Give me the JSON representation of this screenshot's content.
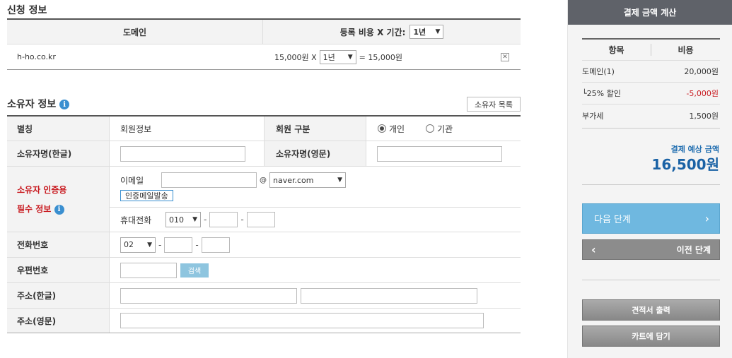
{
  "application": {
    "title": "신청 정보",
    "col_domain": "도메인",
    "col_fee": "등록 비용 X 기간:",
    "period_select": "1년",
    "rows": [
      {
        "domain": "h-ho.co.kr",
        "price": "15,000원 X",
        "period": "1년",
        "result": "= 15,000원"
      }
    ]
  },
  "owner": {
    "title": "소유자 정보",
    "list_button": "소유자 목록",
    "alias_label": "별칭",
    "alias_value": "회원정보",
    "member_type_label": "회원 구분",
    "type_individual": "개인",
    "type_org": "기관",
    "name_kor_label": "소유자명(한글)",
    "name_eng_label": "소유자명(영문)",
    "verify_label_1": "소유자 인증용",
    "verify_label_2": "필수 정보",
    "email_label": "이메일",
    "email_at": "@",
    "email_domain": "naver.com",
    "verify_button": "인증메일발송",
    "mobile_label": "휴대전화",
    "mobile_prefix": "010",
    "phone_label": "전화번호",
    "phone_prefix": "02",
    "zip_label": "우편번호",
    "search_button": "검색",
    "addr_kor_label": "주소(한글)",
    "addr_eng_label": "주소(영문)"
  },
  "sidebar": {
    "title": "결제 금액 계산",
    "col_item": "항목",
    "col_cost": "비용",
    "items": [
      {
        "name": "도메인(1)",
        "cost": "20,000원"
      },
      {
        "name": "└25% 할인",
        "cost": "-5,000원"
      },
      {
        "name": "부가세",
        "cost": "1,500원"
      }
    ],
    "total_label": "결제 예상 금액",
    "total_value": "16,500원",
    "next_button": "다음 단계",
    "prev_button": "이전 단계",
    "quote_button": "견적서 출력",
    "cart_button": "카트에 담기"
  },
  "colors": {
    "accent_blue": "#6fb8e0",
    "discount_red": "#c8181e",
    "total_blue": "#1a62a5"
  }
}
